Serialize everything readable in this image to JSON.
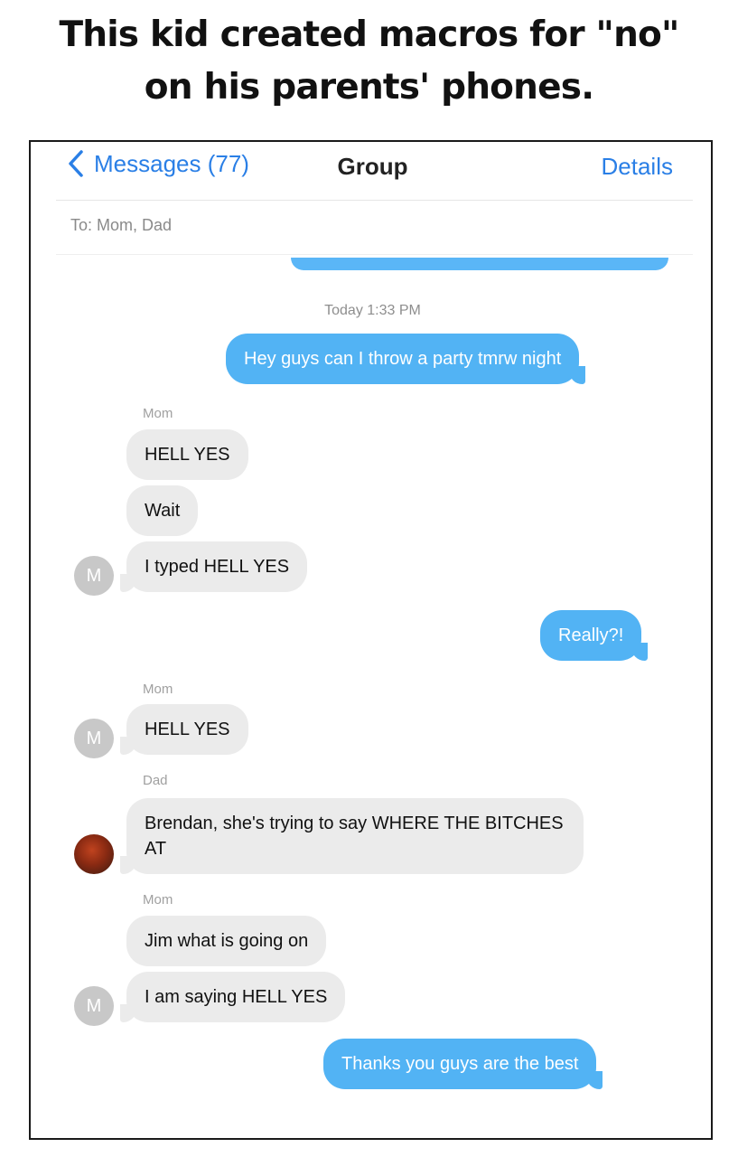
{
  "caption": {
    "line1": "This kid created macros for \"no\"",
    "line2": "on his parents' phones."
  },
  "nav": {
    "back_label": "Messages (77)",
    "title": "Group",
    "details_label": "Details"
  },
  "recipients": "To: Mom, Dad",
  "timestamp": "Today 1:33 PM",
  "messages": [
    {
      "text": "Hey guys can I throw a party tmrw night"
    },
    {
      "sender": "Mom",
      "text": "HELL YES"
    },
    {
      "text": "Wait"
    },
    {
      "text": "I typed HELL YES",
      "avatar": "M"
    },
    {
      "text": "Really?!"
    },
    {
      "sender": "Mom",
      "text": "HELL YES",
      "avatar": "M"
    },
    {
      "sender": "Dad",
      "text": "Brendan, she's trying to say WHERE THE BITCHES AT"
    },
    {
      "sender": "Mom",
      "text": "Jim what is going on"
    },
    {
      "text": "I am saying HELL YES",
      "avatar": "M"
    },
    {
      "text": "Thanks you guys are the best"
    }
  ],
  "colors": {
    "accent": "#2a7fe6",
    "outgoing_bubble": "#52b3f4",
    "incoming_bubble": "#ebebeb"
  },
  "icons": {
    "back": "chevron-left-icon",
    "dad_avatar": "avatar-photo-icon"
  }
}
